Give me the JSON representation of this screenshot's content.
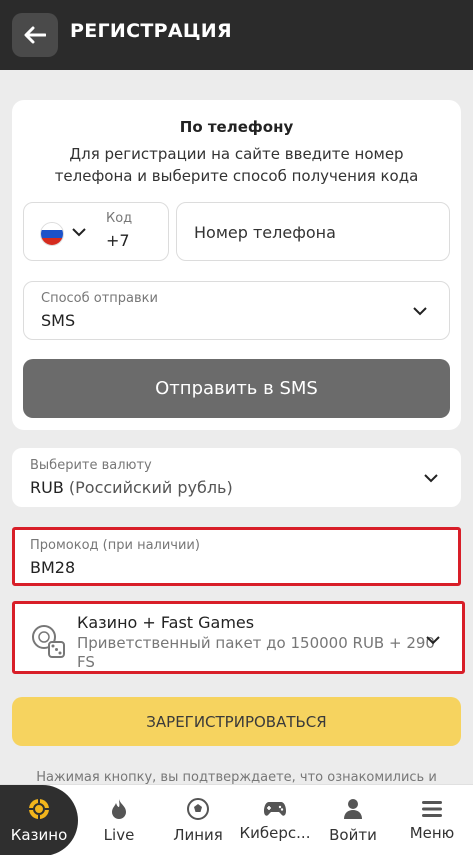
{
  "header": {
    "title": "РЕГИСТРАЦИЯ"
  },
  "phone_section": {
    "title": "По телефону",
    "description": "Для регистрации на сайте введите номер телефона и выберите способ получения кода",
    "code_label": "Код",
    "code_value": "+7",
    "phone_placeholder": "Номер телефона"
  },
  "delivery": {
    "label": "Способ отправки",
    "value": "SMS"
  },
  "send_button": "Отправить в SMS",
  "currency": {
    "label": "Выберите валюту",
    "code": "RUB",
    "name": "(Российский рубль)"
  },
  "promo": {
    "label": "Промокод (при наличии)",
    "value": "BM28"
  },
  "bonus": {
    "title": "Казино + Fast Games",
    "desc_line1": "Приветственный пакет до 150000 RUB + 290",
    "desc_line2": "FS"
  },
  "register_button": "ЗАРЕГИСТРИРОВАТЬСЯ",
  "disclaimer": "Нажимая кнопку, вы подтверждаете, что ознакомились и",
  "bottom_nav": [
    {
      "label": "Казино",
      "icon": "casino-chip-icon"
    },
    {
      "label": "Live",
      "icon": "fire-icon"
    },
    {
      "label": "Линия",
      "icon": "football-icon"
    },
    {
      "label": "Киберс...",
      "icon": "gamepad-icon"
    },
    {
      "label": "Войти",
      "icon": "user-icon"
    },
    {
      "label": "Меню",
      "icon": "menu-icon"
    }
  ],
  "colors": {
    "header_bg": "#2b2b2b",
    "highlight_red": "#d81e28",
    "register_yellow": "#f6d35f",
    "send_gray": "#6b6b6b",
    "casino_gold": "#f2b51c"
  }
}
